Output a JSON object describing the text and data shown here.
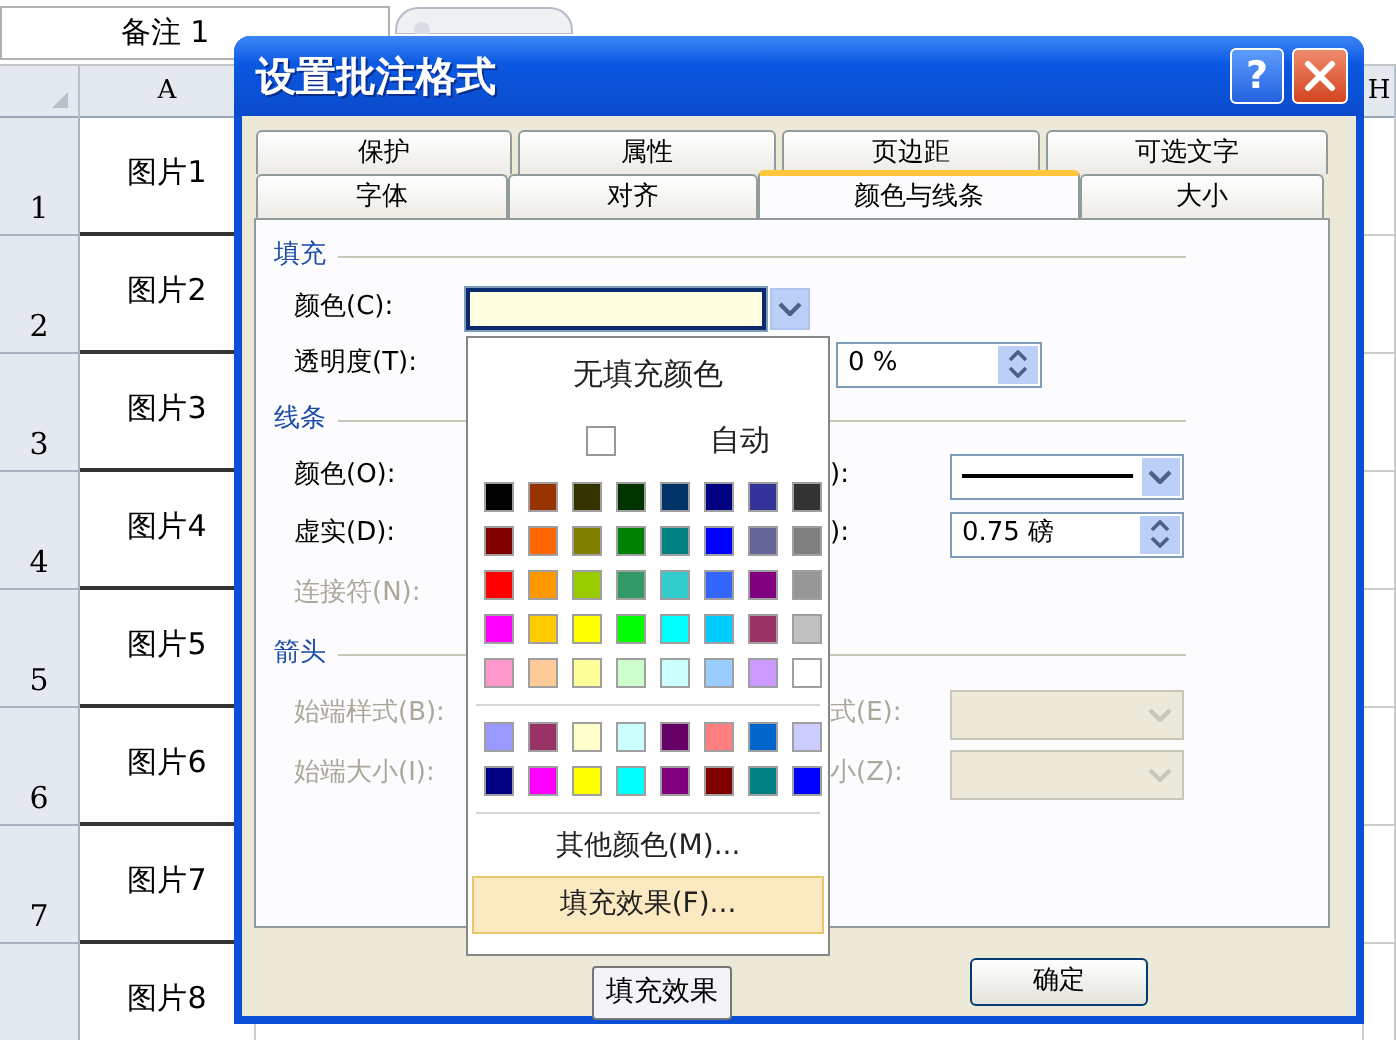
{
  "spreadsheet": {
    "name_box": "备注 1",
    "column_headers": [
      "A",
      "H"
    ],
    "rows": [
      {
        "number": "1",
        "cell": "图片1"
      },
      {
        "number": "2",
        "cell": "图片2"
      },
      {
        "number": "3",
        "cell": "图片3"
      },
      {
        "number": "4",
        "cell": "图片4"
      },
      {
        "number": "5",
        "cell": "图片5"
      },
      {
        "number": "6",
        "cell": "图片6"
      },
      {
        "number": "7",
        "cell": "图片7"
      },
      {
        "cell": "图片8"
      }
    ]
  },
  "dialog": {
    "title": "设置批注格式",
    "help": "?",
    "tabs_back": [
      {
        "label": "保护",
        "selected": false
      },
      {
        "label": "属性",
        "selected": false
      },
      {
        "label": "页边距",
        "selected": false
      },
      {
        "label": "可选文字",
        "selected": false
      }
    ],
    "tabs_front": [
      {
        "label": "字体",
        "selected": false
      },
      {
        "label": "对齐",
        "selected": false
      },
      {
        "label": "颜色与线条",
        "selected": true
      },
      {
        "label": "大小",
        "selected": false
      }
    ],
    "fill": {
      "heading": "填充",
      "color_label": "颜色(C):",
      "color": "#ffffe1",
      "transparency_label": "透明度(T):",
      "transparency_value": "0 %"
    },
    "line": {
      "heading": "线条",
      "color_label": "颜色(O):",
      "dash_label": "虚实(D):",
      "style_label_tail": "):",
      "weight_label_tail": "):",
      "weight_value": "0.75 磅",
      "connector_label": "连接符(N):",
      "connector_disabled": true
    },
    "arrows": {
      "heading": "箭头",
      "disabled": true,
      "begin_style_label": "始端样式(B):",
      "begin_size_label": "始端大小(I):",
      "end_style_label_tail": "式(E):",
      "end_size_label_tail": "小(Z):"
    },
    "ok_button": "确定"
  },
  "color_menu": {
    "no_fill": "无填充颜色",
    "auto": "自动",
    "auto_checked": false,
    "swatch_groups": [
      [
        [
          {
            "color": "#000000"
          },
          {
            "color": "#993300"
          },
          {
            "color": "#333300"
          },
          {
            "color": "#003300"
          },
          {
            "color": "#003366"
          },
          {
            "color": "#000080"
          },
          {
            "color": "#333399"
          },
          {
            "color": "#333333"
          }
        ],
        [
          {
            "color": "#800000"
          },
          {
            "color": "#ff6600"
          },
          {
            "color": "#808000"
          },
          {
            "color": "#008000"
          },
          {
            "color": "#008080"
          },
          {
            "color": "#0000ff"
          },
          {
            "color": "#666699"
          },
          {
            "color": "#808080"
          }
        ],
        [
          {
            "color": "#ff0000"
          },
          {
            "color": "#ff9900"
          },
          {
            "color": "#99cc00"
          },
          {
            "color": "#339966"
          },
          {
            "color": "#33cccc"
          },
          {
            "color": "#3366ff"
          },
          {
            "color": "#800080"
          },
          {
            "color": "#969696"
          }
        ],
        [
          {
            "color": "#ff00ff"
          },
          {
            "color": "#ffcc00"
          },
          {
            "color": "#ffff00"
          },
          {
            "color": "#00ff00"
          },
          {
            "color": "#00ffff"
          },
          {
            "color": "#00ccff"
          },
          {
            "color": "#993366"
          },
          {
            "color": "#c0c0c0"
          }
        ],
        [
          {
            "color": "#ff99cc"
          },
          {
            "color": "#ffcc99"
          },
          {
            "color": "#ffff99"
          },
          {
            "color": "#ccffcc"
          },
          {
            "color": "#ccffff"
          },
          {
            "color": "#99ccff"
          },
          {
            "color": "#cc99ff"
          },
          {
            "color": "#ffffff"
          }
        ]
      ],
      [
        [
          {
            "color": "#9999ff"
          },
          {
            "color": "#993366"
          },
          {
            "color": "#ffffcc"
          },
          {
            "color": "#ccffff"
          },
          {
            "color": "#660066"
          },
          {
            "color": "#ff8080"
          },
          {
            "color": "#0066cc"
          },
          {
            "color": "#ccccff"
          }
        ],
        [
          {
            "color": "#000080"
          },
          {
            "color": "#ff00ff"
          },
          {
            "color": "#ffff00"
          },
          {
            "color": "#00ffff"
          },
          {
            "color": "#800080"
          },
          {
            "color": "#800000"
          },
          {
            "color": "#008080"
          },
          {
            "color": "#0000ff"
          }
        ]
      ]
    ],
    "items": [
      {
        "label": "其他颜色(M)...",
        "highlighted": false
      },
      {
        "label": "填充效果(F)...",
        "highlighted": true
      }
    ]
  },
  "tooltip": "填充效果"
}
